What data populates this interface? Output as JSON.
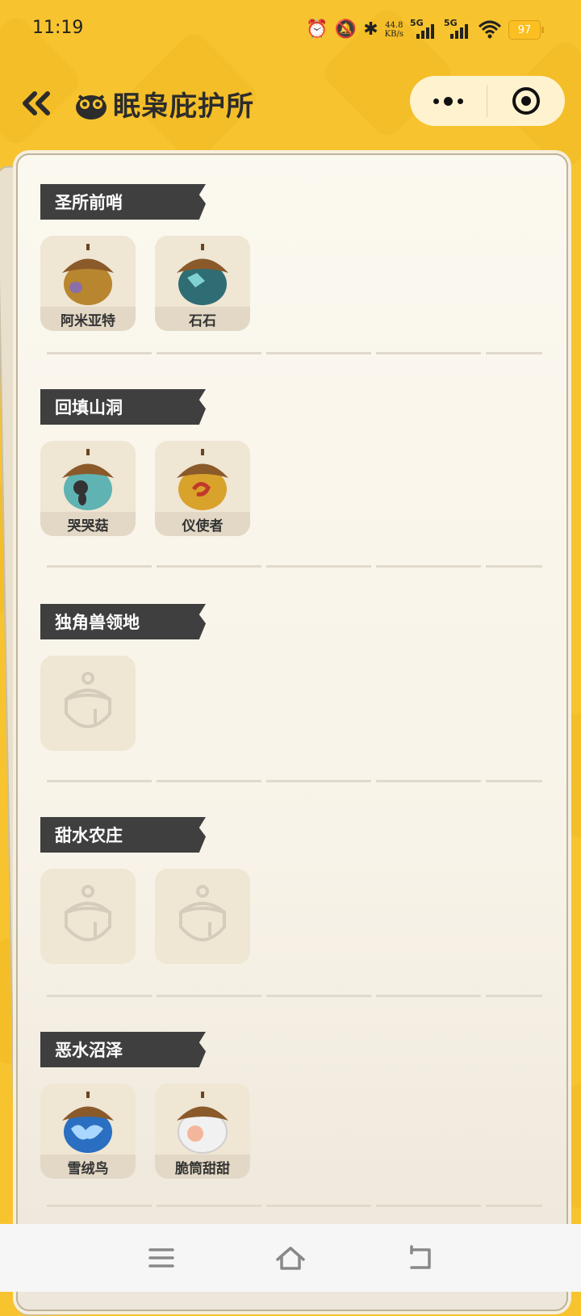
{
  "status_bar": {
    "time": "11:19",
    "net_speed_value": "44.8",
    "net_speed_unit": "KB/s",
    "sim1_label": "5G",
    "sim2_label": "5G",
    "battery": "97"
  },
  "header": {
    "title": "眠枭庇护所",
    "back_icon": "double-chevron-left-icon",
    "more_icon": "more-dots-icon",
    "close_icon": "target-close-icon"
  },
  "sections": [
    {
      "title": "圣所前哨",
      "items": [
        {
          "name": "阿米亚特",
          "collected": true,
          "color": "#b8862e",
          "accent": "#8a6fa8"
        },
        {
          "name": "石石",
          "collected": true,
          "color": "#2f6d74",
          "accent": "#7fd2d0"
        }
      ]
    },
    {
      "title": "回填山洞",
      "items": [
        {
          "name": "哭哭菇",
          "collected": true,
          "color": "#5fb3b3",
          "accent": "#333333"
        },
        {
          "name": "仪使者",
          "collected": true,
          "color": "#d9a22b",
          "accent": "#c0392b"
        }
      ]
    },
    {
      "title": "独角兽领地",
      "items": [
        {
          "name": "",
          "collected": false
        }
      ]
    },
    {
      "title": "甜水农庄",
      "items": [
        {
          "name": "",
          "collected": false
        },
        {
          "name": "",
          "collected": false
        }
      ]
    },
    {
      "title": "恶水沼泽",
      "items": [
        {
          "name": "雪绒鸟",
          "collected": true,
          "color": "#2a6fc1",
          "accent": "#a9d7ff"
        },
        {
          "name": "脆筒甜甜",
          "collected": true,
          "color": "#f1f1f1",
          "accent": "#f4b69a"
        }
      ]
    }
  ],
  "nav": {
    "menu_icon": "menu-icon",
    "home_icon": "home-icon",
    "back_icon": "back-icon"
  }
}
